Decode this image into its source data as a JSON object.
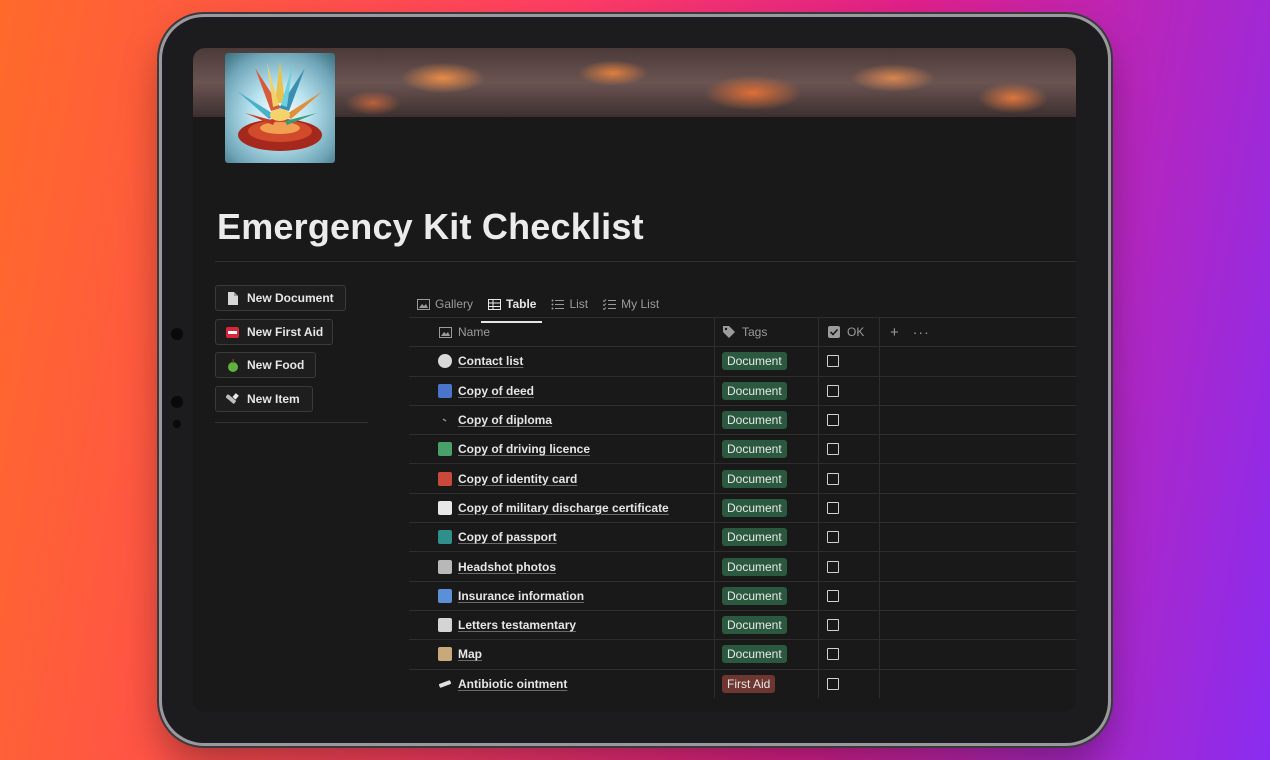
{
  "page": {
    "title": "Emergency Kit Checklist"
  },
  "actions": [
    {
      "label": "New Document",
      "icon": "document-icon"
    },
    {
      "label": "New First Aid",
      "icon": "sos-icon"
    },
    {
      "label": "New Food",
      "icon": "apple-icon"
    },
    {
      "label": "New Item",
      "icon": "flashlight-icon"
    }
  ],
  "views": [
    {
      "label": "Gallery",
      "icon": "gallery-icon",
      "active": false
    },
    {
      "label": "Table",
      "icon": "table-icon",
      "active": true
    },
    {
      "label": "List",
      "icon": "list-icon",
      "active": false
    },
    {
      "label": "My List",
      "icon": "checklist-icon",
      "active": false
    }
  ],
  "table": {
    "columns": {
      "name": "Name",
      "tags": "Tags",
      "ok": "OK",
      "add": "+",
      "more": "···"
    },
    "rows": [
      {
        "name": "Contact list",
        "tag": "Document",
        "ok": false,
        "icon_color": "#d9d9d9"
      },
      {
        "name": "Copy of deed",
        "tag": "Document",
        "ok": false,
        "icon_color": "#4a76c9"
      },
      {
        "name": "Copy of diploma",
        "tag": "Document",
        "ok": false,
        "icon_color": "#8a8a8a"
      },
      {
        "name": "Copy of driving licence",
        "tag": "Document",
        "ok": false,
        "icon_color": "#4aa06b"
      },
      {
        "name": "Copy of identity card",
        "tag": "Document",
        "ok": false,
        "icon_color": "#c94a3a"
      },
      {
        "name": "Copy of military discharge certificate",
        "tag": "Document",
        "ok": false,
        "icon_color": "#e8e8e8"
      },
      {
        "name": "Copy of passport",
        "tag": "Document",
        "ok": false,
        "icon_color": "#2f8f8a"
      },
      {
        "name": "Headshot photos",
        "tag": "Document",
        "ok": false,
        "icon_color": "#b8b8b8"
      },
      {
        "name": "Insurance information",
        "tag": "Document",
        "ok": false,
        "icon_color": "#5b8fd6"
      },
      {
        "name": "Letters testamentary",
        "tag": "Document",
        "ok": false,
        "icon_color": "#d4d4d4"
      },
      {
        "name": "Map",
        "tag": "Document",
        "ok": false,
        "icon_color": "#c9a97a"
      },
      {
        "name": "Antibiotic ointment",
        "tag": "First Aid",
        "ok": false,
        "icon_color": "#e0e0e0"
      }
    ]
  },
  "colors": {
    "tag_document": "#2b593f",
    "tag_first_aid": "#6e3630"
  }
}
